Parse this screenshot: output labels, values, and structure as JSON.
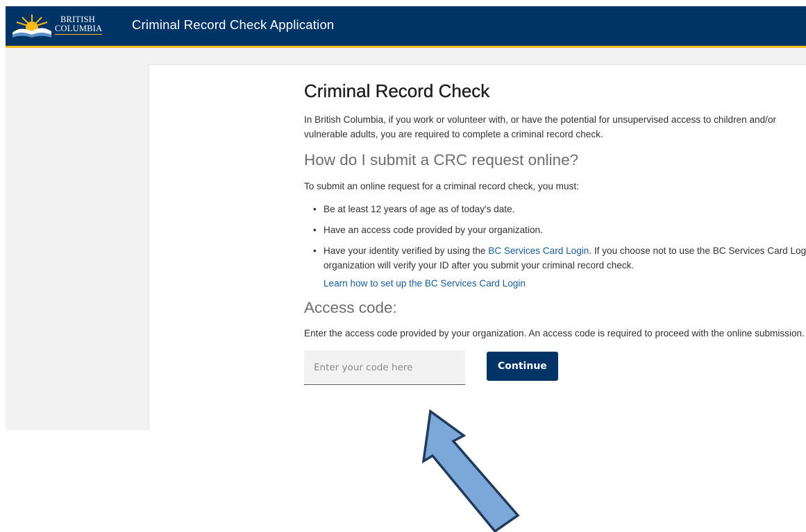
{
  "header": {
    "logo_line1": "BRITISH",
    "logo_line2": "COLUMBIA",
    "app_title": "Criminal Record Check Application"
  },
  "main": {
    "title": "Criminal Record Check",
    "intro": "In British Columbia, if you work or volunteer with, or have the potential for unsupervised access to children and/or vulnerable adults, you are required to complete a criminal record check.",
    "online_heading": "How do I submit a CRC request online?",
    "online_lead": "To submit an online request for a criminal record check, you must:",
    "requirements": [
      "Be at least 12 years of age as of today's date.",
      "Have an access code provided by your organization."
    ],
    "identity_before": "Have your identity verified by using the ",
    "identity_link": "BC Services Card Login",
    "identity_after": ". If you choose not to use the BC Services Card Login, your organization will verify your ID after you submit your criminal record check.",
    "learn_link": "Learn how to set up the BC Services Card Login",
    "access_heading": "Access code:",
    "access_desc": "Enter the access code provided by your organization. An access code is required to proceed with the online submission.",
    "code_placeholder": "Enter your code here",
    "code_value": "",
    "continue_label": "Continue"
  },
  "colors": {
    "header_bg": "#003366",
    "header_accent": "#fcba19",
    "link": "#1a5a96",
    "button_bg": "#003366",
    "arrow_fill": "#7ba7d9",
    "arrow_stroke": "#1f3a5a"
  },
  "icons": {
    "logo": "bc-sun-mountains-logo",
    "annotation": "pointer-arrow-icon"
  }
}
